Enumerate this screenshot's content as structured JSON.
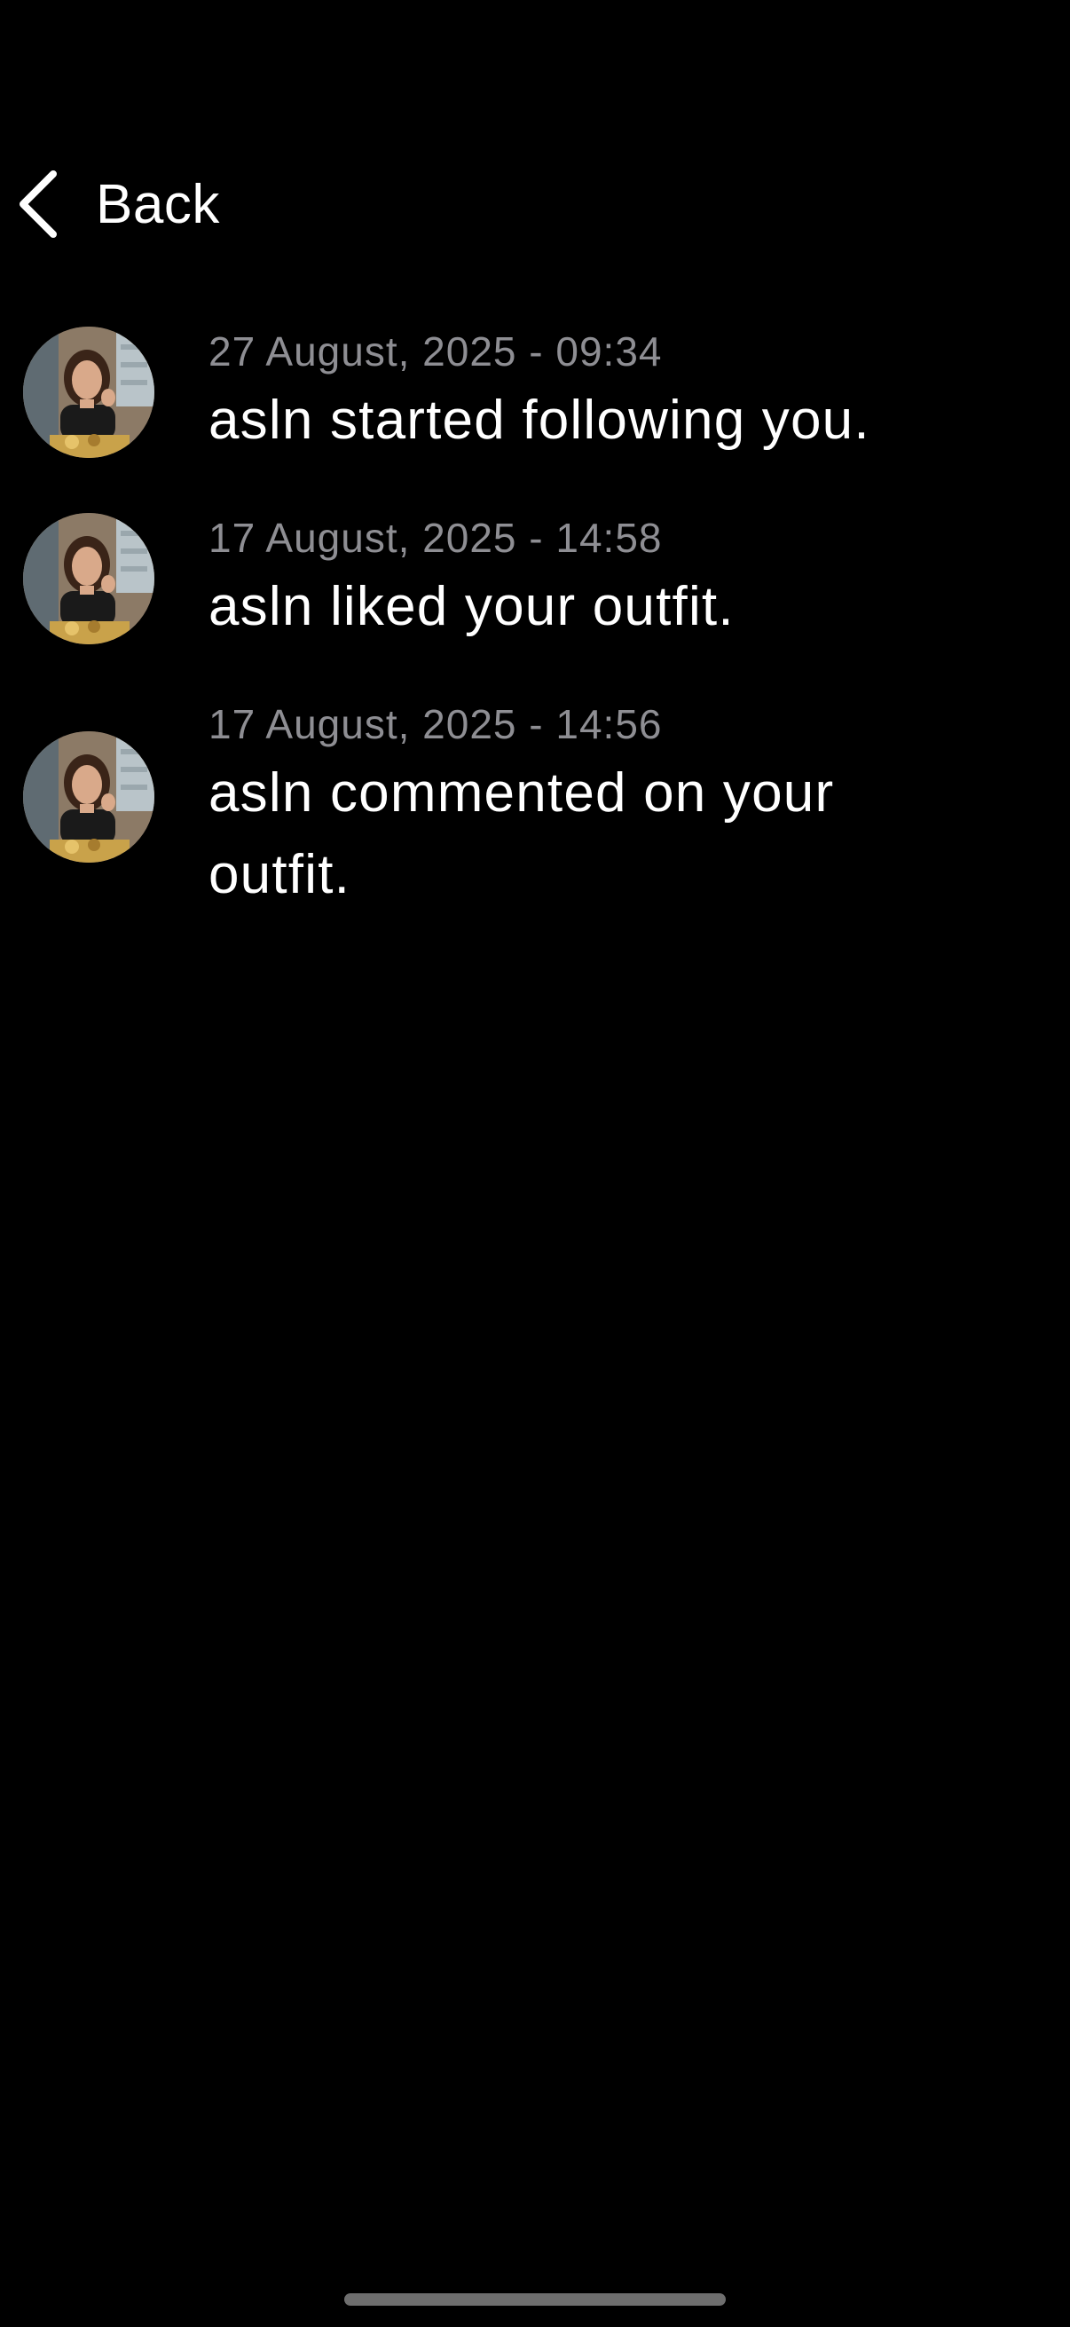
{
  "header": {
    "back_label": "Back",
    "back_icon": "chevron-left-icon"
  },
  "notifications": [
    {
      "timestamp": "27 August, 2025 - 09:34",
      "message": "asln started following you.",
      "avatar": "user-avatar"
    },
    {
      "timestamp": "17 August, 2025 - 14:58",
      "message": "asln liked your outfit.",
      "avatar": "user-avatar"
    },
    {
      "timestamp": "17 August, 2025 - 14:56",
      "message": "asln commented on your outfit.",
      "avatar": "user-avatar"
    }
  ],
  "colors": {
    "background": "#000000",
    "primary_text": "#ffffff",
    "secondary_text": "#8e8e93"
  }
}
